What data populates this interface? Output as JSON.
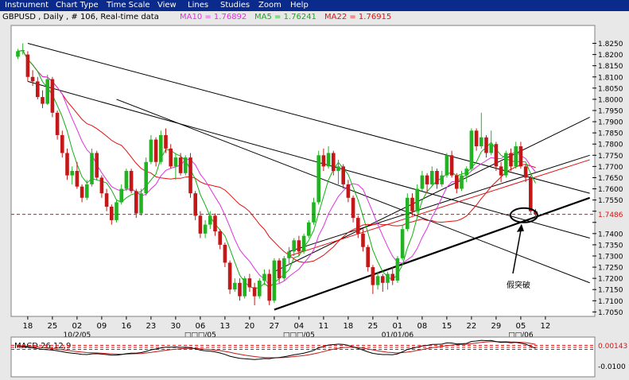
{
  "menu": [
    "Instrument",
    "Chart Type",
    "Time Scale",
    "View",
    "Lines",
    "Studies",
    "Zoom",
    "Help"
  ],
  "header": {
    "symbol_info": "GBPUSD , Daily , # 106, Real-time data",
    "ma10_label": "MA10 = 1.76892",
    "ma5_label": "MA5 = 1.76241",
    "ma22_label": "MA22 = 1.76915"
  },
  "colors": {
    "up": "#22b322",
    "down": "#c41818",
    "ma5": "#10b010",
    "ma10": "#e030e0",
    "ma22": "#e01010",
    "menu_bg": "#0a2a8c",
    "plot_bg": "#ffffff",
    "trend": "#000000",
    "hline": "#e01010"
  },
  "chart_data": {
    "type": "candlestick",
    "instrument": "GBPUSD",
    "timeframe": "Daily",
    "ylim": [
      1.703,
      1.833
    ],
    "yticks": [
      1.705,
      1.71,
      1.715,
      1.72,
      1.725,
      1.73,
      1.735,
      1.74,
      1.745,
      1.75,
      1.755,
      1.76,
      1.765,
      1.77,
      1.775,
      1.78,
      1.785,
      1.79,
      1.795,
      1.8,
      1.805,
      1.81,
      1.815,
      1.82,
      1.825
    ],
    "ytick_labels": [
      "1.7050",
      "1.7100",
      "1.7150",
      "1.7200",
      "1.7250",
      "1.7300",
      "1.7350",
      "1.7400",
      "",
      "",
      "1.7550",
      "1.7600",
      "1.7650",
      "1.7700",
      "1.7750",
      "1.7800",
      "1.7850",
      "1.7900",
      "1.7950",
      "1.8000",
      "1.8050",
      "1.8100",
      "1.8150",
      "1.8200",
      "1.8250"
    ],
    "price_marker": "1.7486",
    "price_level": 1.7486,
    "xticks": [
      {
        "i": 2,
        "label": "18"
      },
      {
        "i": 7,
        "label": "25"
      },
      {
        "i": 12,
        "label": "02"
      },
      {
        "i": 17,
        "label": "09"
      },
      {
        "i": 22,
        "label": "16"
      },
      {
        "i": 27,
        "label": "23"
      },
      {
        "i": 32,
        "label": "30"
      },
      {
        "i": 37,
        "label": "06"
      },
      {
        "i": 42,
        "label": "13"
      },
      {
        "i": 47,
        "label": "20"
      },
      {
        "i": 52,
        "label": "27"
      },
      {
        "i": 57,
        "label": "04"
      },
      {
        "i": 62,
        "label": "11"
      },
      {
        "i": 67,
        "label": "18"
      },
      {
        "i": 72,
        "label": "25"
      },
      {
        "i": 77,
        "label": "01"
      },
      {
        "i": 82,
        "label": "08"
      },
      {
        "i": 87,
        "label": "15"
      },
      {
        "i": 92,
        "label": "22"
      },
      {
        "i": 97,
        "label": "29"
      },
      {
        "i": 102,
        "label": "05"
      },
      {
        "i": 107,
        "label": "12"
      }
    ],
    "period_labels": [
      {
        "i": 12,
        "label": "10/2/05"
      },
      {
        "i": 37,
        "label": "□□□/05"
      },
      {
        "i": 57,
        "label": "□□□/05"
      },
      {
        "i": 77,
        "label": "01/01/06"
      },
      {
        "i": 102,
        "label": "□□/06"
      }
    ],
    "annotation": {
      "text": "假突破",
      "i": 102,
      "price": 1.7482
    },
    "candles": [
      [
        1.819,
        1.8225,
        1.818,
        1.8215
      ],
      [
        1.8215,
        1.825,
        1.82,
        1.822
      ],
      [
        1.82,
        1.8215,
        1.808,
        1.81
      ],
      [
        1.81,
        1.813,
        1.806,
        1.808
      ],
      [
        1.808,
        1.81,
        1.8,
        1.801
      ],
      [
        1.801,
        1.804,
        1.796,
        1.798
      ],
      [
        1.798,
        1.811,
        1.7975,
        1.809
      ],
      [
        1.809,
        1.81,
        1.792,
        1.794
      ],
      [
        1.794,
        1.795,
        1.782,
        1.784
      ],
      [
        1.784,
        1.786,
        1.774,
        1.776
      ],
      [
        1.776,
        1.778,
        1.764,
        1.766
      ],
      [
        1.766,
        1.77,
        1.762,
        1.768
      ],
      [
        1.768,
        1.772,
        1.76,
        1.761
      ],
      [
        1.761,
        1.762,
        1.754,
        1.756
      ],
      [
        1.756,
        1.764,
        1.755,
        1.762
      ],
      [
        1.762,
        1.778,
        1.761,
        1.776
      ],
      [
        1.776,
        1.777,
        1.764,
        1.765
      ],
      [
        1.765,
        1.766,
        1.756,
        1.758
      ],
      [
        1.758,
        1.76,
        1.75,
        1.752
      ],
      [
        1.752,
        1.753,
        1.744,
        1.746
      ],
      [
        1.746,
        1.755,
        1.745,
        1.754
      ],
      [
        1.754,
        1.762,
        1.753,
        1.76
      ],
      [
        1.76,
        1.769,
        1.759,
        1.768
      ],
      [
        1.768,
        1.769,
        1.758,
        1.759
      ],
      [
        1.759,
        1.76,
        1.747,
        1.749
      ],
      [
        1.749,
        1.76,
        1.748,
        1.758
      ],
      [
        1.758,
        1.774,
        1.757,
        1.772
      ],
      [
        1.772,
        1.784,
        1.771,
        1.782
      ],
      [
        1.782,
        1.783,
        1.77,
        1.772
      ],
      [
        1.772,
        1.786,
        1.771,
        1.784
      ],
      [
        1.784,
        1.787,
        1.776,
        1.778
      ],
      [
        1.778,
        1.78,
        1.769,
        1.77
      ],
      [
        1.77,
        1.776,
        1.764,
        1.774
      ],
      [
        1.774,
        1.776,
        1.766,
        1.767
      ],
      [
        1.767,
        1.775,
        1.766,
        1.774
      ],
      [
        1.774,
        1.776,
        1.756,
        1.758
      ],
      [
        1.758,
        1.759,
        1.746,
        1.748
      ],
      [
        1.748,
        1.75,
        1.738,
        1.74
      ],
      [
        1.74,
        1.746,
        1.738,
        1.744
      ],
      [
        1.744,
        1.75,
        1.742,
        1.748
      ],
      [
        1.748,
        1.749,
        1.739,
        1.741
      ],
      [
        1.741,
        1.742,
        1.733,
        1.735
      ],
      [
        1.735,
        1.736,
        1.725,
        1.727
      ],
      [
        1.727,
        1.728,
        1.713,
        1.715
      ],
      [
        1.715,
        1.72,
        1.714,
        1.718
      ],
      [
        1.718,
        1.72,
        1.71,
        1.712
      ],
      [
        1.712,
        1.721,
        1.711,
        1.72
      ],
      [
        1.72,
        1.722,
        1.714,
        1.716
      ],
      [
        1.716,
        1.718,
        1.708,
        1.712
      ],
      [
        1.712,
        1.72,
        1.711,
        1.719
      ],
      [
        1.719,
        1.724,
        1.717,
        1.722
      ],
      [
        1.722,
        1.724,
        1.708,
        1.71
      ],
      [
        1.71,
        1.729,
        1.709,
        1.728
      ],
      [
        1.728,
        1.729,
        1.718,
        1.72
      ],
      [
        1.72,
        1.73,
        1.719,
        1.729
      ],
      [
        1.729,
        1.734,
        1.726,
        1.732
      ],
      [
        1.732,
        1.738,
        1.73,
        1.737
      ],
      [
        1.737,
        1.739,
        1.73,
        1.732
      ],
      [
        1.732,
        1.74,
        1.731,
        1.739
      ],
      [
        1.739,
        1.746,
        1.738,
        1.745
      ],
      [
        1.745,
        1.756,
        1.744,
        1.754
      ],
      [
        1.754,
        1.777,
        1.753,
        1.775
      ],
      [
        1.775,
        1.778,
        1.768,
        1.77
      ],
      [
        1.77,
        1.779,
        1.769,
        1.776
      ],
      [
        1.776,
        1.777,
        1.766,
        1.768
      ],
      [
        1.768,
        1.773,
        1.762,
        1.77
      ],
      [
        1.77,
        1.771,
        1.76,
        1.762
      ],
      [
        1.762,
        1.764,
        1.754,
        1.756
      ],
      [
        1.756,
        1.757,
        1.745,
        1.747
      ],
      [
        1.747,
        1.748,
        1.738,
        1.74
      ],
      [
        1.74,
        1.742,
        1.732,
        1.734
      ],
      [
        1.734,
        1.735,
        1.723,
        1.725
      ],
      [
        1.725,
        1.726,
        1.713,
        1.717
      ],
      [
        1.717,
        1.723,
        1.715,
        1.721
      ],
      [
        1.721,
        1.722,
        1.714,
        1.718
      ],
      [
        1.718,
        1.723,
        1.715,
        1.722
      ],
      [
        1.722,
        1.725,
        1.717,
        1.719
      ],
      [
        1.719,
        1.73,
        1.718,
        1.729
      ],
      [
        1.729,
        1.744,
        1.728,
        1.742
      ],
      [
        1.742,
        1.758,
        1.741,
        1.756
      ],
      [
        1.756,
        1.758,
        1.748,
        1.75
      ],
      [
        1.75,
        1.762,
        1.749,
        1.76
      ],
      [
        1.76,
        1.768,
        1.759,
        1.766
      ],
      [
        1.766,
        1.767,
        1.758,
        1.762
      ],
      [
        1.762,
        1.77,
        1.761,
        1.768
      ],
      [
        1.768,
        1.769,
        1.76,
        1.762
      ],
      [
        1.762,
        1.768,
        1.761,
        1.766
      ],
      [
        1.766,
        1.776,
        1.765,
        1.775
      ],
      [
        1.775,
        1.777,
        1.765,
        1.766
      ],
      [
        1.766,
        1.767,
        1.758,
        1.76
      ],
      [
        1.76,
        1.768,
        1.759,
        1.766
      ],
      [
        1.766,
        1.77,
        1.763,
        1.769
      ],
      [
        1.769,
        1.787,
        1.768,
        1.786
      ],
      [
        1.786,
        1.787,
        1.777,
        1.779
      ],
      [
        1.779,
        1.794,
        1.778,
        1.783
      ],
      [
        1.783,
        1.784,
        1.774,
        1.776
      ],
      [
        1.776,
        1.786,
        1.775,
        1.78
      ],
      [
        1.78,
        1.781,
        1.768,
        1.77
      ],
      [
        1.77,
        1.772,
        1.763,
        1.766
      ],
      [
        1.766,
        1.777,
        1.765,
        1.776
      ],
      [
        1.776,
        1.778,
        1.768,
        1.77
      ],
      [
        1.77,
        1.781,
        1.769,
        1.779
      ],
      [
        1.779,
        1.781,
        1.769,
        1.77
      ],
      [
        1.77,
        1.771,
        1.763,
        1.765
      ],
      [
        1.765,
        1.766,
        1.749,
        1.75
      ],
      [
        1.75,
        1.751,
        1.747,
        1.7486
      ]
    ],
    "trendlines": [
      {
        "i1": 2,
        "p1": 1.825,
        "i2": 116,
        "p2": 1.758,
        "color": "#000000",
        "w": 1
      },
      {
        "i1": 2,
        "p1": 1.808,
        "i2": 116,
        "p2": 1.738,
        "color": "#000000",
        "w": 1
      },
      {
        "i1": 20,
        "p1": 1.8,
        "i2": 116,
        "p2": 1.718,
        "color": "#000000",
        "w": 1
      },
      {
        "i1": 52,
        "p1": 1.706,
        "i2": 116,
        "p2": 1.756,
        "color": "#000000",
        "w": 2.2
      },
      {
        "i1": 52,
        "p1": 1.723,
        "i2": 116,
        "p2": 1.792,
        "color": "#000000",
        "w": 1
      },
      {
        "i1": 55,
        "p1": 1.73,
        "i2": 116,
        "p2": 1.773,
        "color": "#e01010",
        "w": 1
      },
      {
        "i1": 55,
        "p1": 1.732,
        "i2": 116,
        "p2": 1.775,
        "color": "#000000",
        "w": 1
      }
    ],
    "macd": {
      "label": "MACD 26,12,9",
      "ylim": [
        -0.016,
        0.006
      ],
      "tick_labels": [
        {
          "v": 0.00143,
          "label": "0.00143"
        },
        {
          "v": -0.01,
          "label": "-0.0100"
        }
      ],
      "hlines": [
        0.00143,
        0.0003,
        -0.0008
      ],
      "macd": [
        0.001,
        0.0008,
        0.0004,
        0.0,
        -0.0004,
        -0.0008,
        -0.001,
        -0.0012,
        -0.0016,
        -0.0021,
        -0.0026,
        -0.0029,
        -0.0032,
        -0.0036,
        -0.0037,
        -0.0033,
        -0.0032,
        -0.0034,
        -0.0037,
        -0.004,
        -0.004,
        -0.0037,
        -0.0032,
        -0.0029,
        -0.0029,
        -0.0026,
        -0.0019,
        -0.0011,
        -0.0006,
        0.0,
        0.0004,
        0.0004,
        0.0005,
        0.0003,
        0.0004,
        0.0001,
        -0.0005,
        -0.0012,
        -0.0016,
        -0.0018,
        -0.0022,
        -0.0028,
        -0.0036,
        -0.0046,
        -0.0052,
        -0.0058,
        -0.006,
        -0.0062,
        -0.0064,
        -0.0062,
        -0.0059,
        -0.006,
        -0.0055,
        -0.0053,
        -0.0049,
        -0.0044,
        -0.0038,
        -0.0034,
        -0.0029,
        -0.0022,
        -0.0014,
        0.0,
        0.0008,
        0.0016,
        0.0018,
        0.0021,
        0.0019,
        0.0014,
        0.0006,
        -0.0003,
        -0.0012,
        -0.0022,
        -0.003,
        -0.0034,
        -0.0037,
        -0.0037,
        -0.0038,
        -0.0033,
        -0.0022,
        -0.0008,
        -0.0002,
        0.0004,
        0.0011,
        0.0014,
        0.0019,
        0.002,
        0.0021,
        0.0028,
        0.0027,
        0.0022,
        0.0023,
        0.0025,
        0.0036,
        0.0038,
        0.0042,
        0.004,
        0.0041,
        0.0035,
        0.003,
        0.0032,
        0.0028,
        0.0031,
        0.0026,
        0.0021,
        0.0009,
        -0.0002
      ],
      "signal": [
        0.0012,
        0.0011,
        0.001,
        0.0008,
        0.0005,
        0.0002,
        -0.0001,
        -0.0004,
        -0.0007,
        -0.001,
        -0.0013,
        -0.0017,
        -0.002,
        -0.0023,
        -0.0026,
        -0.0027,
        -0.0028,
        -0.0029,
        -0.0031,
        -0.0033,
        -0.0034,
        -0.0035,
        -0.0034,
        -0.0033,
        -0.0032,
        -0.0031,
        -0.0028,
        -0.0025,
        -0.0021,
        -0.0017,
        -0.0013,
        -0.001,
        -0.0007,
        -0.0005,
        -0.0003,
        -0.0002,
        -0.0003,
        -0.0005,
        -0.0007,
        -0.0009,
        -0.0012,
        -0.0015,
        -0.0019,
        -0.0024,
        -0.003,
        -0.0035,
        -0.004,
        -0.0044,
        -0.0048,
        -0.0051,
        -0.0053,
        -0.0054,
        -0.0055,
        -0.0054,
        -0.0053,
        -0.0051,
        -0.0048,
        -0.0045,
        -0.0042,
        -0.0038,
        -0.0033,
        -0.0027,
        -0.002,
        -0.0013,
        -0.0007,
        -0.0002,
        0.0002,
        0.0004,
        0.0004,
        0.0002,
        -0.0001,
        -0.0006,
        -0.0011,
        -0.0016,
        -0.002,
        -0.0024,
        -0.0026,
        -0.0028,
        -0.0026,
        -0.0023,
        -0.0019,
        -0.0014,
        -0.0009,
        -0.0004,
        0.0001,
        0.0005,
        0.0009,
        0.0013,
        0.0016,
        0.0018,
        0.0019,
        0.002,
        0.0024,
        0.0027,
        0.003,
        0.0033,
        0.0035,
        0.0035,
        0.0034,
        0.0034,
        0.0033,
        0.0032,
        0.0031,
        0.0029,
        0.0025,
        0.002
      ]
    }
  }
}
